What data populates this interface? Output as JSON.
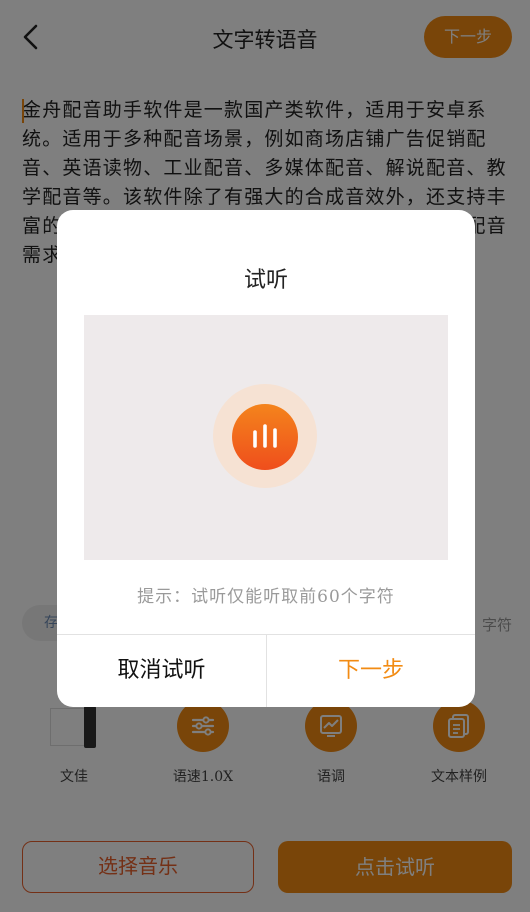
{
  "header": {
    "title": "文字转语音",
    "next_label": "下一步"
  },
  "editor": {
    "text": "金舟配音助手软件是一款国产类软件，适用于安卓系统。适用于多种配音场景，例如商场店铺广告促销配音、英语读物、工业配音、多媒体配音、解说配音、教学配音等。该软件除了有强大的合成音效外，还支持丰富的配音主播、海量模板素材等，满足不同场景的配音需求，一键生成语音。"
  },
  "toolbar": {
    "pill_left": "存",
    "char_hint": "字符",
    "tools": [
      {
        "label": "文佳",
        "icon": "voice-avatar"
      },
      {
        "label": "语速1.0X",
        "icon": "sliders-icon"
      },
      {
        "label": "语调",
        "icon": "chart-icon"
      },
      {
        "label": "文本样例",
        "icon": "document-icon"
      }
    ]
  },
  "bottom": {
    "choose_music": "选择音乐",
    "click_listen": "点击试听"
  },
  "dialog": {
    "title": "试听",
    "play_icon": "audio-wave-icon",
    "hint": "提示：试听仅能听取前60个字符",
    "cancel": "取消试听",
    "next": "下一步"
  },
  "colors": {
    "accent": "#f28b13",
    "accent_dark": "#ef4e1c",
    "overlay": "rgba(0,0,0,0.5)"
  }
}
